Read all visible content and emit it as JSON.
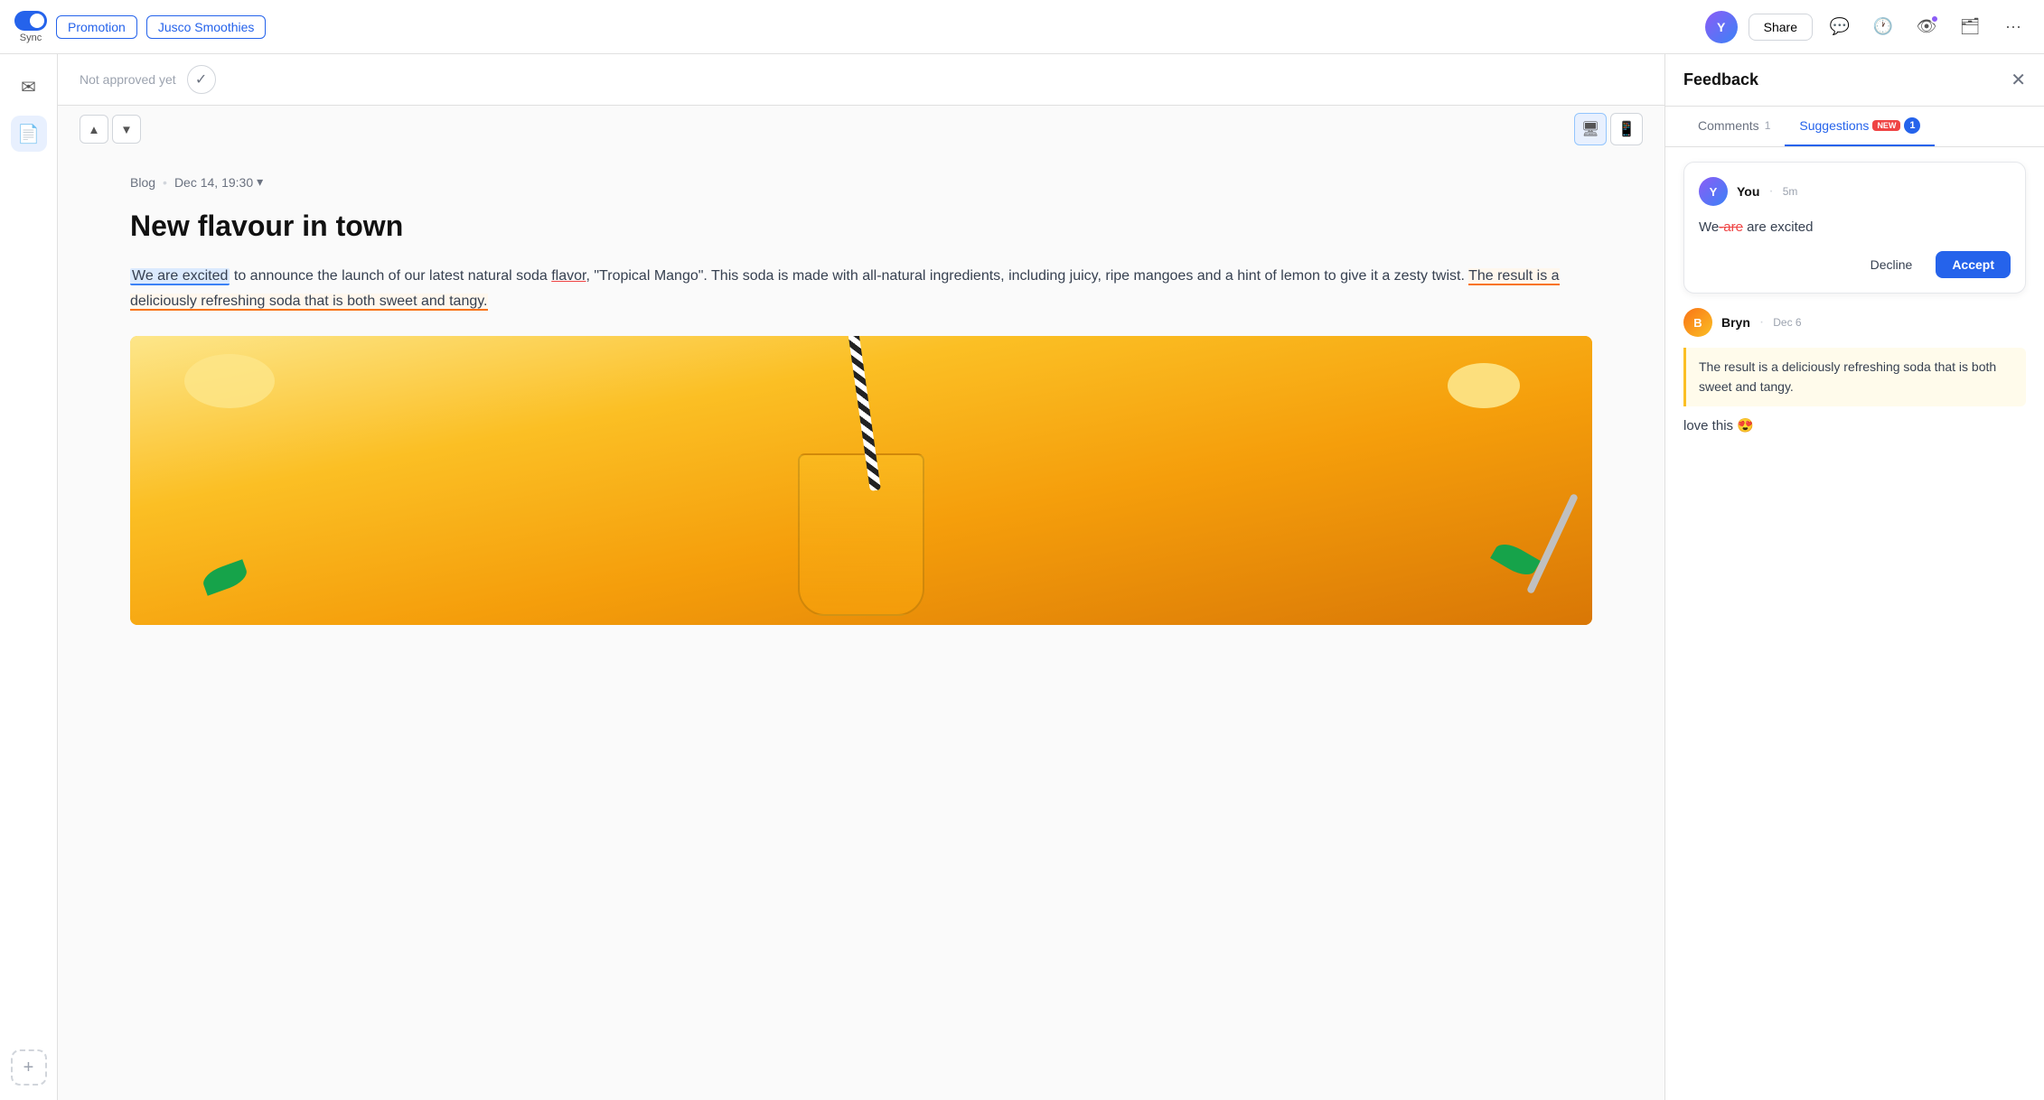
{
  "topbar": {
    "sync_label": "Sync",
    "promotion_tag": "Promotion",
    "project_tag": "Jusco Smoothies",
    "share_label": "Share"
  },
  "sidebar": {
    "icons": [
      "✉",
      "📄"
    ],
    "add_label": "+"
  },
  "approval": {
    "not_approved_label": "Not approved yet"
  },
  "blog": {
    "source": "Blog",
    "date": "Dec 14, 19:30",
    "title": "New flavour in town",
    "paragraph": "to announce the launch of our latest natural soda",
    "highlighted": "We are excited",
    "underlined_word": "flavor",
    "quoted_segment": "The result is a deliciously refreshing soda that is both sweet and tangy.",
    "rest_body": ", \"Tropical Mango\". This soda is made with all-natural ingredients, including juicy, ripe mangoes and a hint of lemon to give it a zesty twist."
  },
  "feedback": {
    "title": "Feedback",
    "tabs": [
      {
        "label": "Comments",
        "count": "1",
        "active": false
      },
      {
        "label": "Suggestions",
        "badge_new": "NEW",
        "count": "1",
        "active": true
      }
    ],
    "suggestion": {
      "user": "You",
      "time": "5m",
      "original": "We",
      "strikethrough": "-are",
      "replacement": "are excited",
      "decline_label": "Decline",
      "accept_label": "Accept"
    },
    "comment": {
      "user": "Bryn",
      "date": "Dec 6",
      "quoted": "The result is a deliciously refreshing soda that is both sweet and tangy.",
      "body": "love this 😍"
    }
  }
}
